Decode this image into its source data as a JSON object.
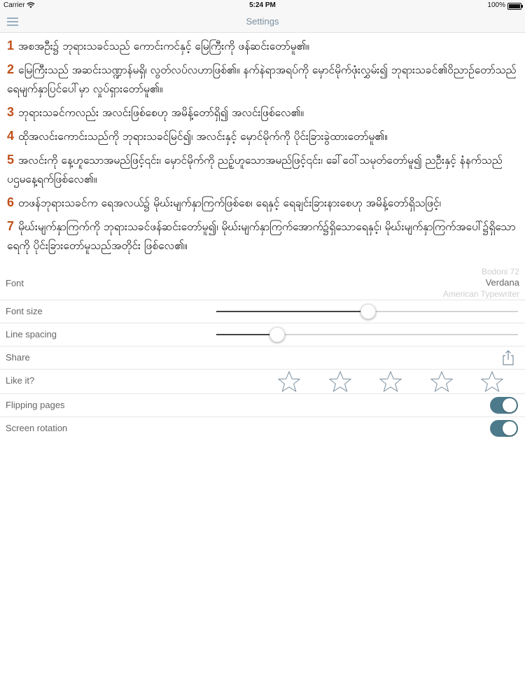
{
  "status_bar": {
    "carrier": "Carrier",
    "time": "5:24 PM",
    "battery": "100%"
  },
  "nav": {
    "title": "Settings"
  },
  "preview": {
    "verses": [
      {
        "num": "1",
        "text": "အစအဦး၌ ဘုရားသခင်သည် ကောင်းကင်နှင့် မြေကြီးကို ဖန်ဆင်းတော်မူ၏။"
      },
      {
        "num": "2",
        "text": "မြေကြီးသည် အဆင်းသဏ္ဍာန်မရှိ၊ လွတ်လပ်လဟာဖြစ်၏။ နက်နဲရာအရပ်ကို မှောင်မိုက်ဖုံးလွှမ်း၍ ဘုရားသခင်၏ဝိညာဉ်တော်သည် ရေမျက်နှာပြင်ပေါ်မှာ လှုပ်ရှားတော်မူ၏။"
      },
      {
        "num": "3",
        "text": "ဘုရားသခင်ကလည်း အလင်းဖြစ်စေဟု အမိန့်တော်ရှိ၍ အလင်းဖြစ်လေ၏။"
      },
      {
        "num": "4",
        "text": "ထိုအလင်းကောင်းသည်ကို ဘုရားသခင်မြင်၍၊ အလင်းနှင့် မှောင်မိုက်ကို ပိုင်းခြားခွဲထားတော်မူ၏။"
      },
      {
        "num": "5",
        "text": "အလင်းကို နေ့ဟူသောအမည်ဖြင့်၎င်း၊ မှောင်မိုက်ကို ညဥ့်ဟူသောအမည်ဖြင့်၎င်း၊ ခေါ်ဝေါ်သမုတ်တော်မူ၍ ညဦးနှင့် နံနက်သည် ပဌမနေ့ရက်ဖြစ်လေ၏။"
      },
      {
        "num": "6",
        "text": "တဖန်ဘုရားသခင်က ရေအလယ်၌ မိုဃ်းမျက်နှာကြက်ဖြစ်စေ၊ ရေနှင့် ရေချင်းခြားနားစေဟု အမိန့်တော်ရှိသဖြင့်၊"
      },
      {
        "num": "7",
        "text": "မိုဃ်းမျက်နှာကြက်ကို ဘုရားသခင်ဖန်ဆင်းတော်မူ၍၊ မိုဃ်းမျက်နှာကြက်အောက်၌ရှိသောရေနှင့်၊ မိုဃ်းမျက်နှာကြက်အပေါ်၌ရှိသောရေကို ပိုင်းခြားတော်မူသည်အတိုင်း ဖြစ်လေ၏။"
      }
    ]
  },
  "settings": {
    "font": {
      "label": "Font",
      "options": [
        "Bodoni 72",
        "Verdana",
        "American Typewriter"
      ],
      "selected": "Verdana"
    },
    "font_size": {
      "label": "Font size",
      "value": 0.5
    },
    "line_spacing": {
      "label": "Line spacing",
      "value": 0.2
    },
    "share": {
      "label": "Share"
    },
    "like": {
      "label": "Like it?",
      "stars_total": 5,
      "stars_filled": 0
    },
    "flipping_pages": {
      "label": "Flipping pages",
      "on": true
    },
    "screen_rotation": {
      "label": "Screen rotation",
      "on": true
    }
  },
  "colors": {
    "verse_number": "#c0501a",
    "toggle_on": "#4d7a8a",
    "nav_title": "#7a8f9f"
  }
}
